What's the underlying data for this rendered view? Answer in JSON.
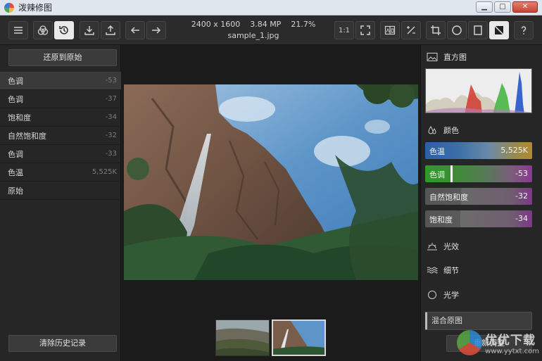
{
  "window": {
    "title": "泼辣修图",
    "buttons": {
      "minimize": "▁",
      "maximize": "□",
      "close": "✕"
    }
  },
  "toolbar": {
    "dimensions": "2400 x 1600",
    "megapixels": "3.84 MP",
    "zoom": "21.7%",
    "filename": "sample_1.jpg",
    "zoom_1to1_label": "1:1"
  },
  "left_panel": {
    "restore_label": "还原到原始",
    "clear_history_label": "清除历史记录",
    "history": [
      {
        "name": "色调",
        "value": "-53"
      },
      {
        "name": "色调",
        "value": "-37"
      },
      {
        "name": "饱和度",
        "value": "-34"
      },
      {
        "name": "自然饱和度",
        "value": "-32"
      },
      {
        "name": "色调",
        "value": "-33"
      },
      {
        "name": "色温",
        "value": "5,525K"
      },
      {
        "name": "原始",
        "value": ""
      }
    ]
  },
  "right_panel": {
    "histogram_label": "直方图",
    "color_label": "颜色",
    "sliders": [
      {
        "name": "色温",
        "value": "5,525K",
        "level": 0.3
      },
      {
        "name": "色调",
        "value": "-53",
        "level": 0.24
      },
      {
        "name": "自然饱和度",
        "value": "-32",
        "level": 0.34
      },
      {
        "name": "饱和度",
        "value": "-34",
        "level": 0.33
      }
    ],
    "light_label": "光效",
    "detail_label": "细节",
    "optics_label": "光学",
    "blend_label": "混合原图",
    "reset_label": "重新调整"
  },
  "watermark": {
    "text": "优优下载",
    "url": "www.yytxt.com"
  },
  "colors": {
    "accent_blue": "#2f63a8",
    "accent_green": "#46a13a",
    "accent_purple": "#7a3b8c"
  }
}
